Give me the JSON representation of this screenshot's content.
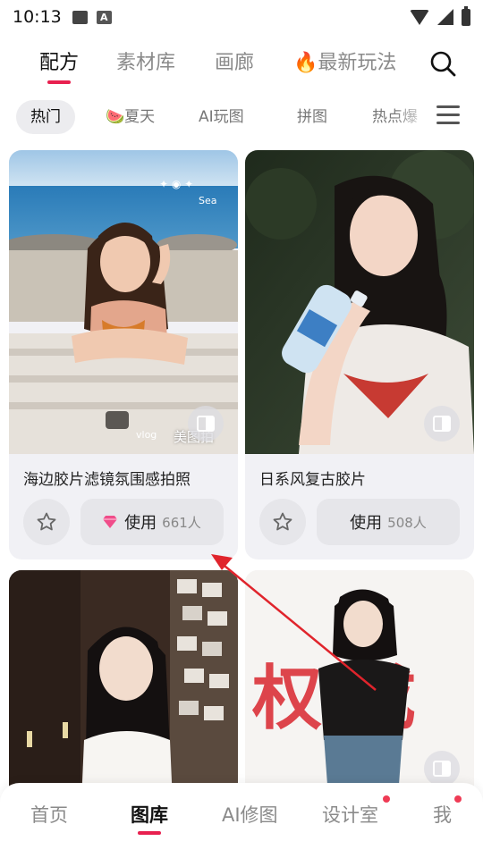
{
  "status_bar": {
    "time": "10:13",
    "icons": [
      "image-icon",
      "a-icon",
      "wifi-icon",
      "signal-icon",
      "battery-icon"
    ]
  },
  "top_tabs": [
    {
      "label": "配方",
      "active": true
    },
    {
      "label": "素材库",
      "active": false
    },
    {
      "label": "画廊",
      "active": false
    },
    {
      "label": "🔥最新玩法",
      "active": false
    }
  ],
  "chips": [
    {
      "label": "热门",
      "active": true
    },
    {
      "label": "🍉夏天",
      "active": false
    },
    {
      "label": "AI玩图",
      "active": false
    },
    {
      "label": "拼图",
      "active": false
    },
    {
      "label": "热点爆",
      "active": false
    }
  ],
  "cards": [
    {
      "title": "海边胶片滤镜氛围感拍照",
      "use_label": "使用",
      "use_count": "661人",
      "watermark": "美图拍",
      "photo_tag": "Sea",
      "photo_tag2": "vlog"
    },
    {
      "title": "日系风复古胶片",
      "use_label": "使用",
      "use_count": "508人"
    },
    {
      "title": ""
    },
    {
      "title": "",
      "photo_text": "权  成"
    }
  ],
  "bottom_nav": [
    {
      "label": "首页",
      "active": false,
      "dot": false
    },
    {
      "label": "图库",
      "active": true,
      "dot": false
    },
    {
      "label": "AI修图",
      "active": false,
      "dot": false
    },
    {
      "label": "设计室",
      "active": false,
      "dot": true
    },
    {
      "label": "我",
      "active": false,
      "dot": true
    }
  ],
  "colors": {
    "accent": "#e8204f",
    "dot": "#ef3b55",
    "card_bg": "#f1f1f5",
    "arrow": "#e0242c"
  }
}
